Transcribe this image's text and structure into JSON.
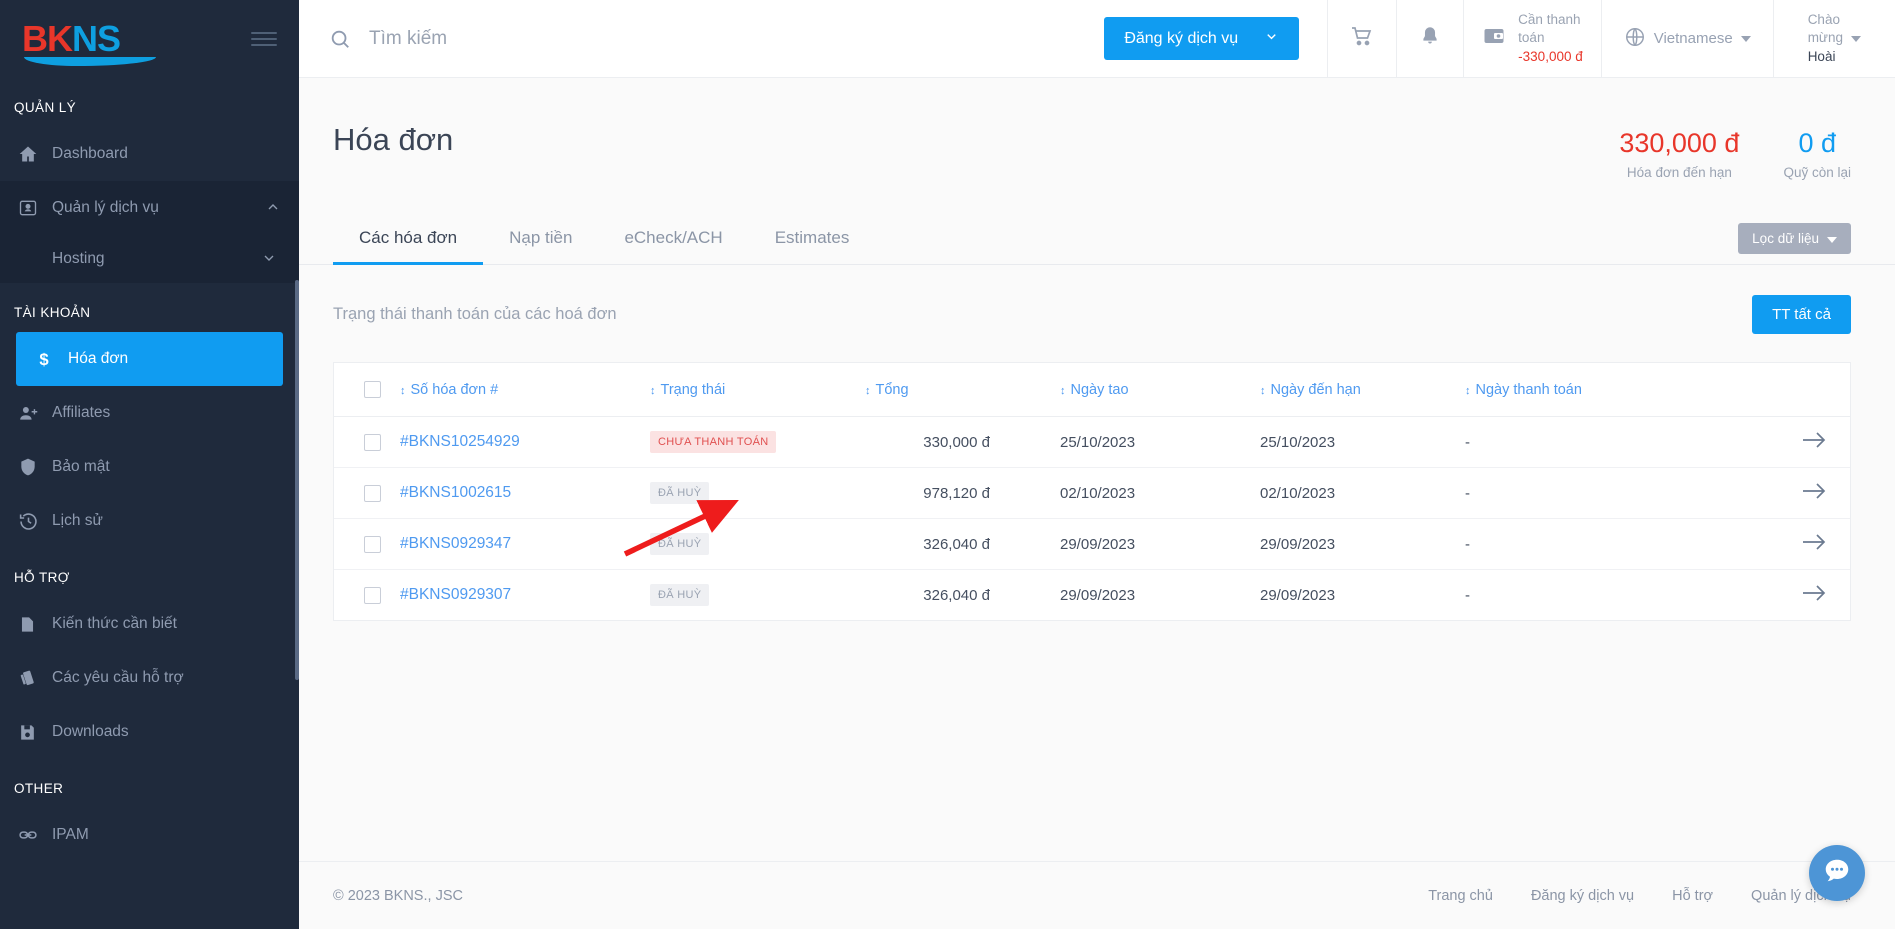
{
  "brand": {
    "name_part1": "BK",
    "name_part2": "NS"
  },
  "sidebar": {
    "sections": [
      {
        "title": "QUẢN LÝ",
        "items": [
          {
            "label": "Dashboard",
            "icon": "home-icon",
            "state": "normal"
          },
          {
            "label": "Quản lý dịch vụ",
            "icon": "contact-card-icon",
            "state": "expanded",
            "chevron": "chevron-up-icon"
          }
        ],
        "sub_items": [
          {
            "label": "Hosting",
            "chevron": "chevron-down-icon"
          }
        ]
      },
      {
        "title": "TÀI KHOẢN",
        "items": [
          {
            "label": "Hóa đơn",
            "icon": "dollar-icon",
            "state": "active"
          },
          {
            "label": "Affiliates",
            "icon": "add-user-icon",
            "state": "normal"
          },
          {
            "label": "Bảo mật",
            "icon": "shield-icon",
            "state": "normal"
          },
          {
            "label": "Lịch sử",
            "icon": "history-icon",
            "state": "normal"
          }
        ]
      },
      {
        "title": "HỖ TRỢ",
        "items": [
          {
            "label": "Kiến thức cần biết",
            "icon": "document-icon",
            "state": "normal"
          },
          {
            "label": "Các yêu cầu hỗ trợ",
            "icon": "tickets-icon",
            "state": "normal"
          },
          {
            "label": "Downloads",
            "icon": "save-disk-icon",
            "state": "normal"
          }
        ]
      },
      {
        "title": "OTHER",
        "items": [
          {
            "label": "IPAM",
            "icon": "link-icon",
            "state": "normal"
          }
        ]
      }
    ]
  },
  "topbar": {
    "search_placeholder": "Tìm kiếm",
    "search_value": "",
    "cta_label": "Đăng ký dịch vụ",
    "cart_icon": "cart-icon",
    "bell_icon": "bell-icon",
    "wallet_icon": "wallet-icon",
    "wallet_label_line1": "Cần thanh",
    "wallet_label_line2": "toán",
    "wallet_amount": "-330,000 đ",
    "globe_icon": "globe-icon",
    "language": "Vietnamese",
    "greet_line1": "Chào",
    "greet_line2": "mừng",
    "greet_name": "Hoài"
  },
  "page": {
    "title": "Hóa đơn",
    "stats": [
      {
        "value": "330,000 đ",
        "label": "Hóa đơn đến hạn",
        "color": "#e8362a"
      },
      {
        "value": "0 đ",
        "label": "Quỹ còn lại",
        "color": "#109cf1"
      }
    ],
    "tabs": [
      {
        "label": "Các hóa đơn",
        "active": true
      },
      {
        "label": "Nạp tiền",
        "active": false
      },
      {
        "label": "eCheck/ACH",
        "active": false
      },
      {
        "label": "Estimates",
        "active": false
      }
    ],
    "filter_label": "Lọc dữ liệu",
    "status_text": "Trạng thái thanh toán của các hoá đơn",
    "pay_all_label": "TT tất cả"
  },
  "table": {
    "headers": [
      "Số hóa đơn #",
      "Trạng thái",
      "Tổng",
      "Ngày tao",
      "Ngày đến hạn",
      "Ngày thanh toán"
    ],
    "rows": [
      {
        "invoice": "#BKNS10254929",
        "status": "CHƯA THANH TOÁN",
        "status_kind": "unpaid",
        "total": "330,000 đ",
        "created": "25/10/2023",
        "due": "25/10/2023",
        "paid": "-"
      },
      {
        "invoice": "#BKNS1002615",
        "status": "ĐÃ HUỲ",
        "status_kind": "cancel",
        "total": "978,120 đ",
        "created": "02/10/2023",
        "due": "02/10/2023",
        "paid": "-"
      },
      {
        "invoice": "#BKNS0929347",
        "status": "ĐÃ HUỲ",
        "status_kind": "cancel",
        "total": "326,040 đ",
        "created": "29/09/2023",
        "due": "29/09/2023",
        "paid": "-"
      },
      {
        "invoice": "#BKNS0929307",
        "status": "ĐÃ HUỲ",
        "status_kind": "cancel",
        "total": "326,040 đ",
        "created": "29/09/2023",
        "due": "29/09/2023",
        "paid": "-"
      }
    ]
  },
  "footer": {
    "copyright": "© 2023 BKNS., JSC",
    "links": [
      "Trang chủ",
      "Đăng ký dịch vụ",
      "Hỗ trợ",
      "Quản lý dịch vụ"
    ]
  },
  "chat": {
    "icon": "chat-bubble-icon"
  },
  "colors": {
    "accent": "#109cf1",
    "danger": "#e8362a",
    "sidebar": "#1f2a3c",
    "link": "#4f9af0"
  }
}
